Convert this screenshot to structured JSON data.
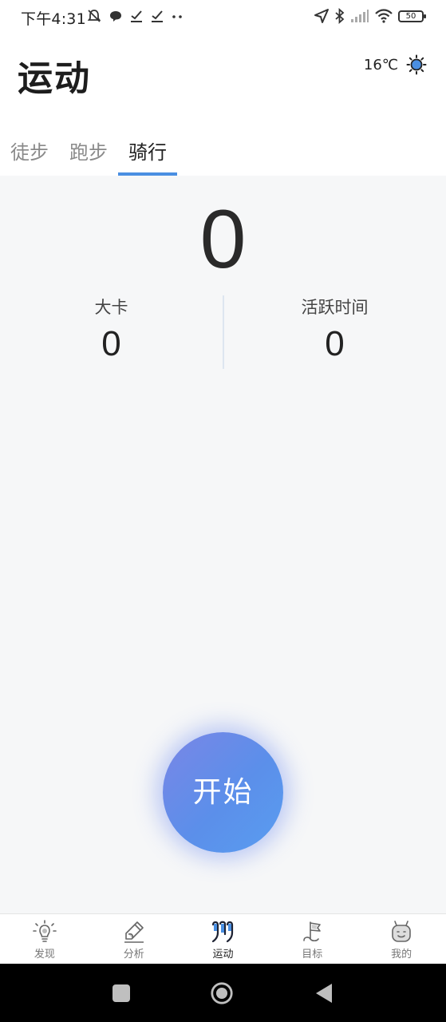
{
  "status_bar": {
    "time": "下午4:31",
    "battery": "50"
  },
  "header": {
    "title": "运动",
    "weather": {
      "temperature": "16℃",
      "icon": "sun-icon"
    }
  },
  "tabs": [
    {
      "label": "徒步",
      "active": false
    },
    {
      "label": "跑步",
      "active": false
    },
    {
      "label": "骑行",
      "active": true
    }
  ],
  "main": {
    "distance_value": "0",
    "stats": [
      {
        "label": "大卡",
        "value": "0"
      },
      {
        "label": "活跃时间",
        "value": "0"
      }
    ],
    "start_button": "开始"
  },
  "bottom_nav": [
    {
      "label": "发现",
      "icon": "bulb-icon",
      "active": false
    },
    {
      "label": "分析",
      "icon": "pen-icon",
      "active": false
    },
    {
      "label": "运动",
      "icon": "sport-icon",
      "active": true
    },
    {
      "label": "目标",
      "icon": "flag-icon",
      "active": false
    },
    {
      "label": "我的",
      "icon": "profile-icon",
      "active": false
    }
  ],
  "colors": {
    "accent": "#4a8fe2",
    "start_gradient_from": "#7a86e6",
    "start_gradient_to": "#5a9df0"
  }
}
